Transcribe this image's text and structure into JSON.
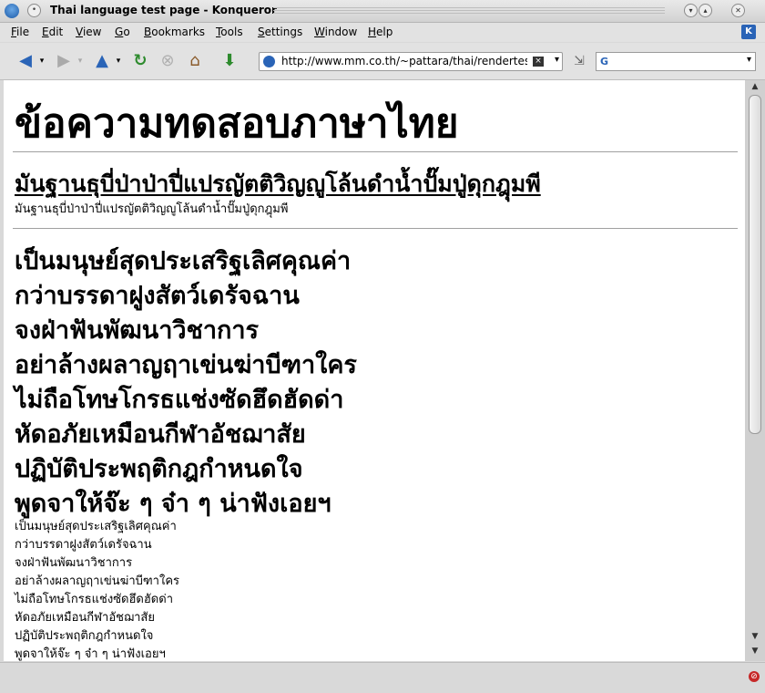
{
  "window": {
    "title": "Thai language test page - Konqueror"
  },
  "menu": {
    "items": [
      {
        "key": "F",
        "rest": "ile"
      },
      {
        "key": "E",
        "rest": "dit"
      },
      {
        "key": "V",
        "rest": "iew"
      },
      {
        "key": "G",
        "rest": "o"
      },
      {
        "key": "B",
        "rest": "ookmarks"
      },
      {
        "key": "T",
        "rest": "ools"
      },
      {
        "key": "S",
        "rest": "ettings"
      },
      {
        "key": "W",
        "rest": "indow"
      },
      {
        "key": "H",
        "rest": "elp"
      }
    ]
  },
  "toolbar": {
    "url": "http://www.mm.co.th/~pattara/thai/rendertest.html",
    "search_value": ""
  },
  "page": {
    "heading": "ข้อความทดสอบภาษาไทย",
    "subheading": "มันฐานธุบี่ป่าป่าปี่แปรญัตติวิญญูโล้นดำน้ำปั๊มปู่ดุกฎุมพี",
    "subheading_small": "มันฐานธุบี่ป่าป่าปี่แปรญัตติวิญญูโล้นดำน้ำปั๊มปู่ดุกฎุมพี",
    "poem_large": [
      "เป็นมนุษย์สุดประเสริฐเลิศคุณค่า",
      "กว่าบรรดาฝูงสัตว์เดรัจฉาน",
      "จงฝ่าฟันพัฒนาวิชาการ",
      "อย่าล้างผลาญฤาเข่นฆ่าบีฑาใคร",
      "ไม่ถือโทษโกรธแช่งซัดฮึดฮัดด่า",
      "หัดอภัยเหมือนกีฬาอัชฌาสัย",
      "ปฏิบัติประพฤติกฎกำหนดใจ",
      "พูดจาให้จ๊ะ ๆ จ๋า ๆ น่าฟังเอยฯ"
    ],
    "poem_small": [
      "เป็นมนุษย์สุดประเสริฐเลิศคุณค่า",
      "กว่าบรรดาฝูงสัตว์เดรัจฉาน",
      "จงฝ่าฟันพัฒนาวิชาการ",
      "อย่าล้างผลาญฤาเข่นฆ่าบีฑาใคร",
      "ไม่ถือโทษโกรธแช่งซัดฮึดฮัดด่า",
      "หัดอภัยเหมือนกีฬาอัชฌาสัย",
      "ปฏิบัติประพฤติกฎกำหนดใจ",
      "พูดจาให้จ๊ะ ๆ จ๋า ๆ น่าฟังเอยฯ"
    ]
  },
  "icons": {
    "app": "konqueror-icon",
    "back": "back-arrow-icon",
    "forward": "forward-arrow-icon",
    "up": "up-arrow-icon",
    "reload": "reload-icon",
    "stop": "stop-icon",
    "home": "home-icon",
    "download": "download-icon"
  }
}
